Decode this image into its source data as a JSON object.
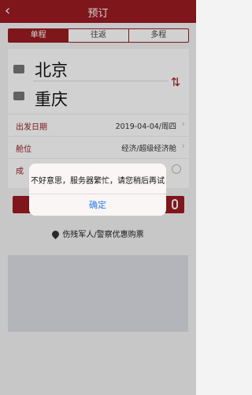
{
  "header": {
    "title": "预订",
    "back_icon": "chevron-left-icon"
  },
  "tabs": [
    {
      "label": "单程",
      "active": true
    },
    {
      "label": "往返",
      "active": false
    },
    {
      "label": "多程",
      "active": false
    }
  ],
  "route": {
    "from_city": "北京",
    "to_city": "重庆",
    "swap_icon": "swap-arrows-icon"
  },
  "form": {
    "departure_label": "出发日期",
    "departure_value": "2019-04-04/周四",
    "cabin_label": "舱位",
    "cabin_value": "经济/超级经济舱",
    "third_label": "成"
  },
  "discount": {
    "label": "伤残军人/警察优惠购票"
  },
  "dialog": {
    "message": "不好意思，服务器繁忙，请您稍后再试",
    "ok_label": "确定"
  },
  "colors": {
    "brand": "#9b1c22",
    "link": "#2a7cf0"
  }
}
